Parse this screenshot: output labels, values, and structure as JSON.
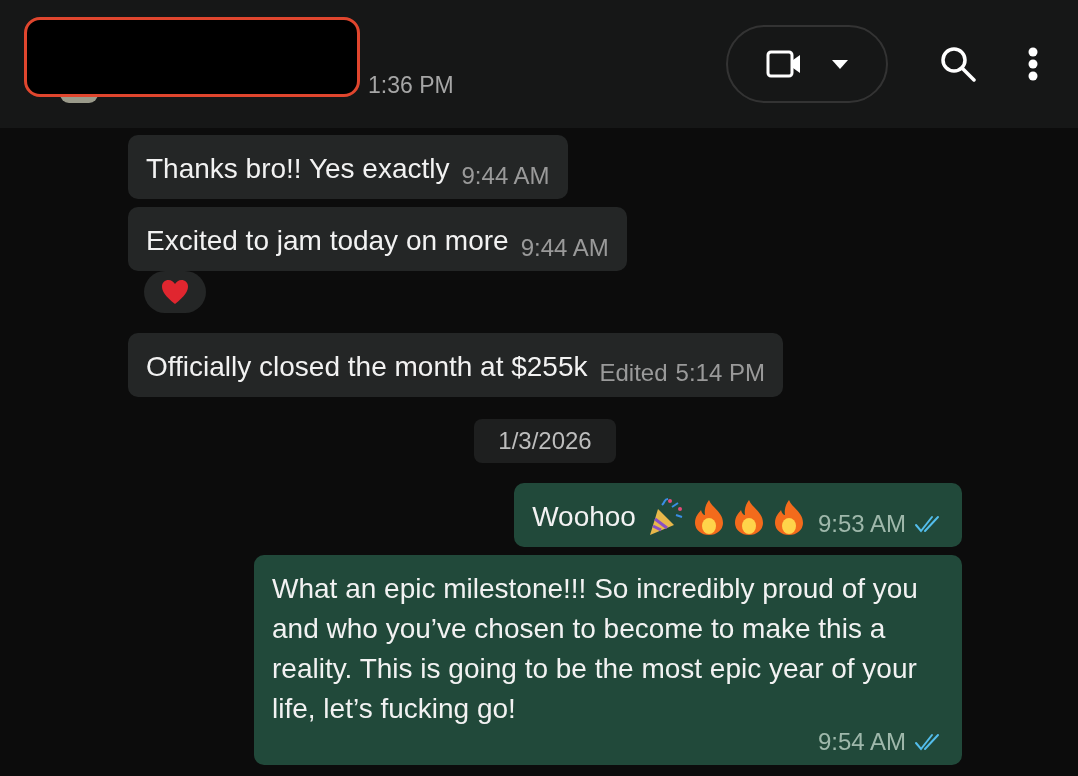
{
  "header": {
    "redacted": true,
    "status": "1:36 PM"
  },
  "messages": [
    {
      "kind": "incoming",
      "text": "Thanks bro!! Yes exactly",
      "time": "9:44 AM"
    },
    {
      "kind": "incoming",
      "text": "Excited to jam today on more",
      "time": "9:44 AM",
      "reactions": [
        {
          "kind": "heart"
        }
      ]
    },
    {
      "kind": "incoming",
      "text": "Officially closed the month at $255k",
      "time": "5:14 PM",
      "edited": "Edited"
    },
    {
      "kind": "date",
      "text": "1/3/2026"
    },
    {
      "kind": "outgoing",
      "text": "Woohoo",
      "emojis": [
        {
          "kind": "party"
        },
        {
          "kind": "fire"
        },
        {
          "kind": "fire"
        },
        {
          "kind": "fire"
        }
      ],
      "time": "9:53 AM",
      "read": true
    },
    {
      "kind": "outgoing",
      "text": "What an epic milestone!!! So incredibly proud of you and who you’ve chosen to become to make this a reality. This is going to be the most epic year of your life, let’s fucking go!",
      "time": "9:54 AM",
      "read": true
    }
  ]
}
